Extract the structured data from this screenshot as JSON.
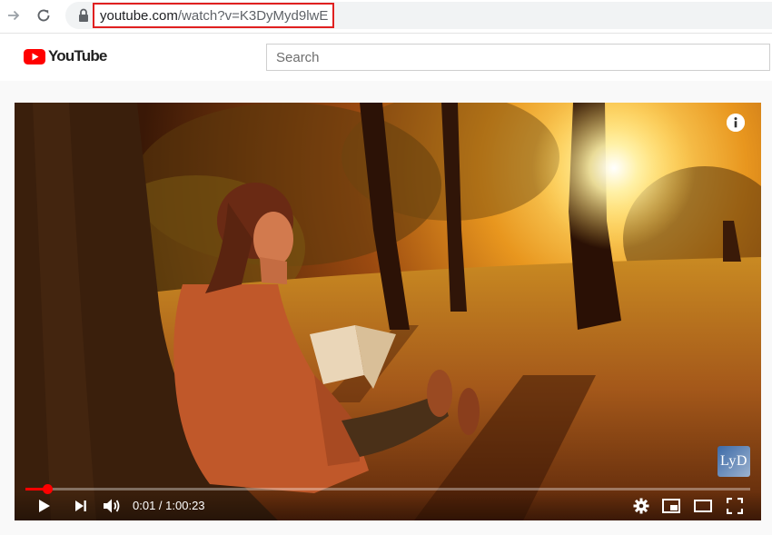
{
  "browser": {
    "url_highlight": "youtube.com",
    "url_rest": "/watch?v=K3DyMyd9lwE"
  },
  "header": {
    "logo_text": "YouTube",
    "search_placeholder": "Search"
  },
  "player": {
    "current_time": "0:01",
    "separator": " / ",
    "duration": "1:00:23",
    "progress_fraction": 0.03,
    "watermark_text": "LyD"
  },
  "colors": {
    "brand_red": "#ff0000",
    "url_box_border": "#e02020"
  }
}
